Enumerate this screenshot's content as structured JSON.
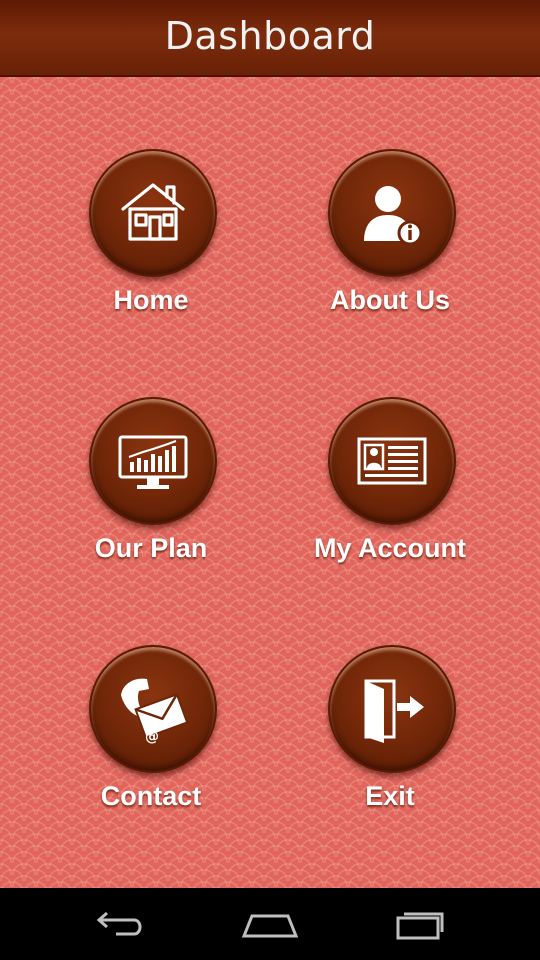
{
  "header": {
    "title": "Dashboard"
  },
  "menu": {
    "home": {
      "label": "Home",
      "icon": "house-icon"
    },
    "about": {
      "label": "About Us",
      "icon": "user-info-icon"
    },
    "plan": {
      "label": "Our Plan",
      "icon": "chart-monitor-icon"
    },
    "account": {
      "label": "My Account",
      "icon": "id-card-icon"
    },
    "contact": {
      "label": "Contact",
      "icon": "phone-mail-icon"
    },
    "exit": {
      "label": "Exit",
      "icon": "exit-door-icon"
    }
  },
  "navbar": {
    "back": {
      "icon": "back-icon"
    },
    "home": {
      "icon": "home-icon"
    },
    "recents": {
      "icon": "recent-apps-icon"
    }
  },
  "colors": {
    "header": "#6a2107",
    "background": "#e1655c",
    "button": "#6f2608",
    "label": "#ffffff"
  }
}
